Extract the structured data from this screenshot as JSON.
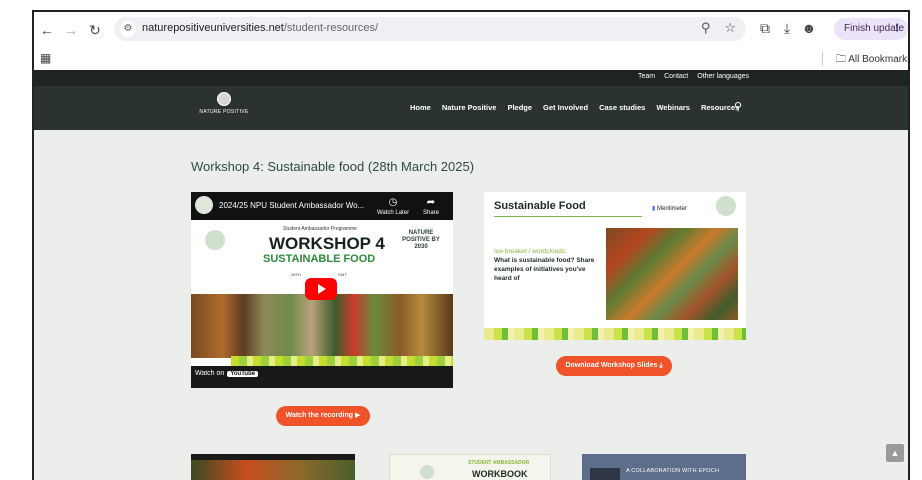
{
  "browser": {
    "url_domain": "naturepositiveuniversities.net",
    "url_path": "/student-resources/",
    "finish_update": "Finish update",
    "all_bookmarks": "All Bookmarks"
  },
  "site": {
    "topbar_links": [
      "Team",
      "Contact",
      "Other languages"
    ],
    "logo_text": "NATURE POSITIVE",
    "nav": [
      "Home",
      "Nature Positive",
      "Pledge",
      "Get Involved",
      "Case studies",
      "Webinars",
      "Resources"
    ]
  },
  "main": {
    "heading": "Workshop 4: Sustainable food (28th March 2025)",
    "video": {
      "title": "2024/25 NPU Student Ambassador Wo...",
      "watch_later": "Watch Later",
      "share": "Share",
      "thumb_subtitle": "Student Ambassador Programme",
      "thumb_title": "WORKSHOP 4",
      "thumb_subtitle2": "SUSTAINABLE FOOD",
      "thumb_date": "28TH",
      "thumb_gmt": "GMT",
      "thumb_badge": "NATURE POSITIVE BY 2030",
      "watch_on": "Watch on",
      "youtube": "YouTube"
    },
    "watch_recording": "Watch the recording",
    "slide": {
      "title": "Sustainable Food",
      "mentimeter": "Mentimeter",
      "icebreaker": "Ice-breaker / wordclouds:",
      "question": "What is sustainable food? Share examples of initiatives you've heard of"
    },
    "download_slides": "Download Workshop Slides",
    "bottom_cards": {
      "card2_line1": "STUDENT AMBASSADOR",
      "card2_line2": "WORKBOOK",
      "card3_text": "A COLLABORATION WITH EPOCH"
    }
  }
}
